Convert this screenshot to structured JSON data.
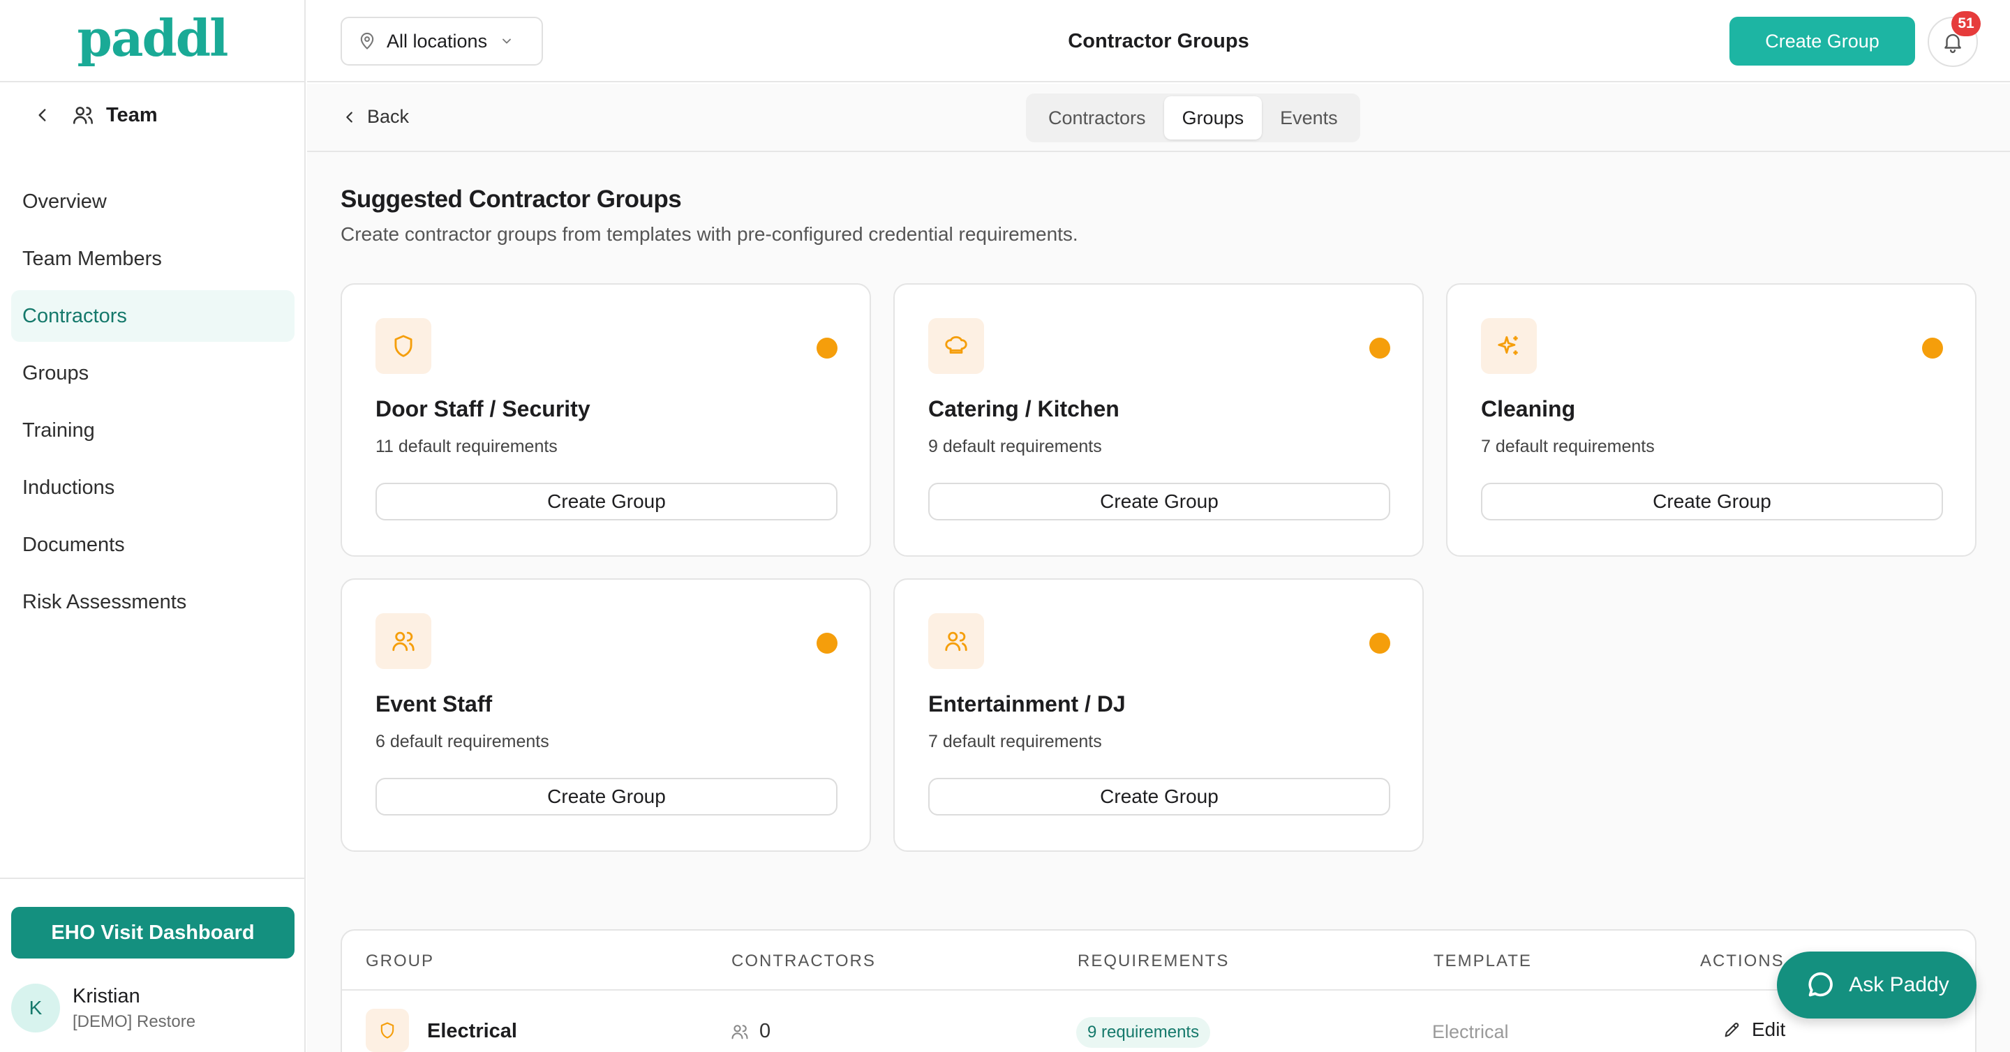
{
  "app": {
    "logo": "paddl"
  },
  "header": {
    "location": "All locations",
    "title": "Contractor Groups",
    "create_button": "Create Group",
    "notification_count": "51"
  },
  "sidebar": {
    "section": "Team",
    "items": [
      {
        "label": "Overview"
      },
      {
        "label": "Team Members"
      },
      {
        "label": "Contractors"
      },
      {
        "label": "Groups"
      },
      {
        "label": "Training"
      },
      {
        "label": "Inductions"
      },
      {
        "label": "Documents"
      },
      {
        "label": "Risk Assessments"
      }
    ],
    "active_item": "Contractors",
    "eho_button": "EHO Visit Dashboard",
    "user": {
      "initial": "K",
      "name": "Kristian",
      "org": "[DEMO] Restore"
    }
  },
  "subnav": {
    "back_label": "Back",
    "tabs": [
      {
        "label": "Contractors"
      },
      {
        "label": "Groups"
      },
      {
        "label": "Events"
      }
    ],
    "active_tab": "Groups"
  },
  "suggested": {
    "title": "Suggested Contractor Groups",
    "subtitle": "Create contractor groups from templates with pre-configured credential requirements.",
    "accent_color": "#f59e0b",
    "cards": [
      {
        "name": "Door Staff / Security",
        "requirements": "11 default requirements",
        "button": "Create Group",
        "icon": "shield-icon"
      },
      {
        "name": "Catering / Kitchen",
        "requirements": "9 default requirements",
        "button": "Create Group",
        "icon": "chef-hat-icon"
      },
      {
        "name": "Cleaning",
        "requirements": "7 default requirements",
        "button": "Create Group",
        "icon": "sparkles-icon"
      },
      {
        "name": "Event Staff",
        "requirements": "6 default requirements",
        "button": "Create Group",
        "icon": "users-icon"
      },
      {
        "name": "Entertainment / DJ",
        "requirements": "7 default requirements",
        "button": "Create Group",
        "icon": "users-icon"
      }
    ]
  },
  "table": {
    "columns": [
      "GROUP",
      "CONTRACTORS",
      "REQUIREMENTS",
      "TEMPLATE",
      "ACTIONS"
    ],
    "rows": [
      {
        "group": "Electrical",
        "contractors": "0",
        "requirements": "9 requirements",
        "template": "Electrical",
        "action": "Edit"
      }
    ]
  },
  "assistant": {
    "label": "Ask Paddy"
  },
  "colors": {
    "brand": "#1aaa96",
    "primary_button": "#1db5a3",
    "dark_teal": "#14907f",
    "badge": "#e63b3b"
  }
}
